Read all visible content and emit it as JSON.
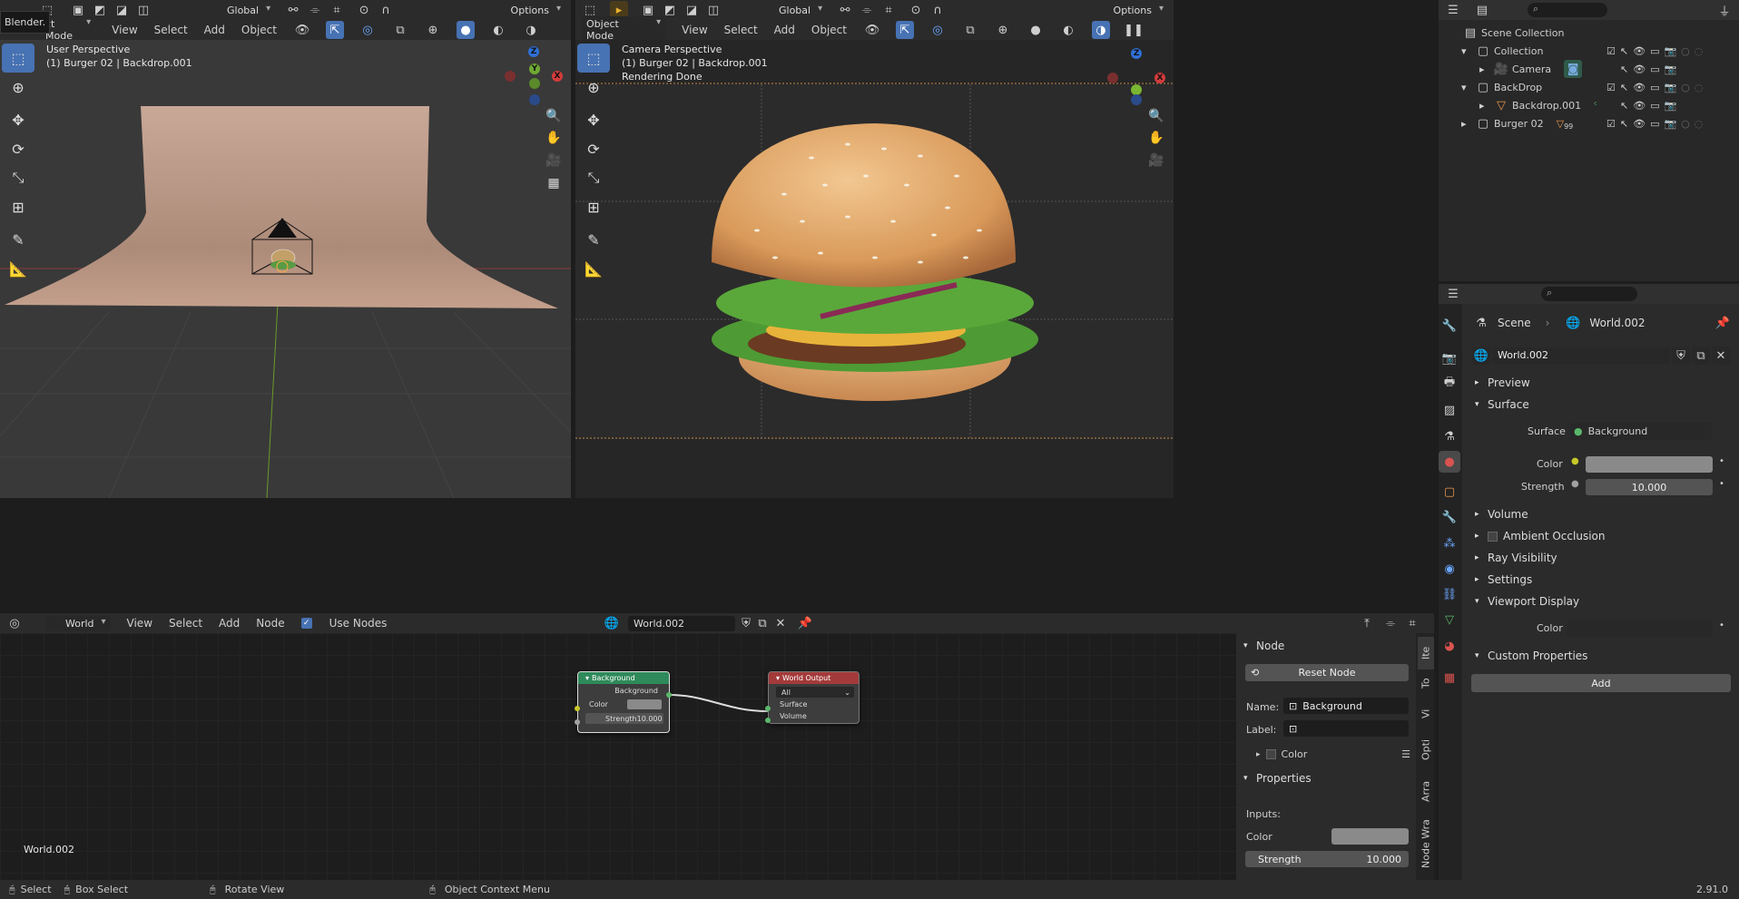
{
  "tooltip": "Blender.",
  "left_viewport": {
    "mode": "Object Mode",
    "mode_visible": "ct Mode",
    "menu": [
      "View",
      "Select",
      "Add",
      "Object"
    ],
    "orientation": "Global",
    "options": "Options",
    "overlay_title": "User Perspective",
    "overlay_sub": "(1) Burger 02 | Backdrop.001"
  },
  "right_viewport": {
    "mode": "Object Mode",
    "menu": [
      "View",
      "Select",
      "Add",
      "Object"
    ],
    "orientation": "Global",
    "options": "Options",
    "overlay_title": "Camera Perspective",
    "overlay_sub": "(1) Burger 02 | Backdrop.001",
    "overlay_status": "Rendering Done"
  },
  "outliner": {
    "items": [
      {
        "label": "Scene Collection"
      },
      {
        "label": "Collection"
      },
      {
        "label": "Camera"
      },
      {
        "label": "BackDrop"
      },
      {
        "label": "Backdrop.001"
      },
      {
        "label": "Burger 02"
      }
    ],
    "burger_badge": "99"
  },
  "properties": {
    "breadcrumb_scene": "Scene",
    "breadcrumb_world": "World.002",
    "world_name": "World.002",
    "preview": "Preview",
    "surface": "Surface",
    "surface_label": "Surface",
    "surface_value": "Background",
    "color_label": "Color",
    "strength_label": "Strength",
    "strength_value": "10.000",
    "volume": "Volume",
    "ambient_occlusion": "Ambient Occlusion",
    "ray_visibility": "Ray Visibility",
    "settings": "Settings",
    "viewport_display": "Viewport Display",
    "vd_color_label": "Color",
    "custom_properties": "Custom Properties",
    "add": "Add",
    "colors": {
      "accent": "#4772b3",
      "world_icon": "#d9534f"
    }
  },
  "node_editor": {
    "editor_type": "World",
    "menu": [
      "View",
      "Select",
      "Add",
      "Node"
    ],
    "use_nodes": "Use Nodes",
    "world_name": "World.002",
    "footer_label": "World.002",
    "background_node": {
      "title": "Background",
      "out": "Background",
      "color": "Color",
      "strength_label": "Strength",
      "strength": "10.000",
      "header_color": "#2e8a5a"
    },
    "output_node": {
      "title": "World Output",
      "target": "All",
      "surface": "Surface",
      "volume": "Volume",
      "header_color": "#a33a3a"
    }
  },
  "node_panel": {
    "node_title": "Node",
    "reset": "Reset Node",
    "name_label": "Name:",
    "name_value": "Background",
    "label_label": "Label:",
    "color_label": "Color",
    "properties": "Properties",
    "inputs": "Inputs:",
    "in_color": "Color",
    "in_strength": "Strength",
    "in_strength_value": "10.000",
    "tabs": [
      "Ite",
      "To",
      "Vi",
      "Opti",
      "Arra",
      "Node Wra"
    ]
  },
  "status_bar": {
    "select": "Select",
    "box_select": "Box Select",
    "rotate": "Rotate View",
    "context": "Object Context Menu",
    "version": "2.91.0"
  }
}
